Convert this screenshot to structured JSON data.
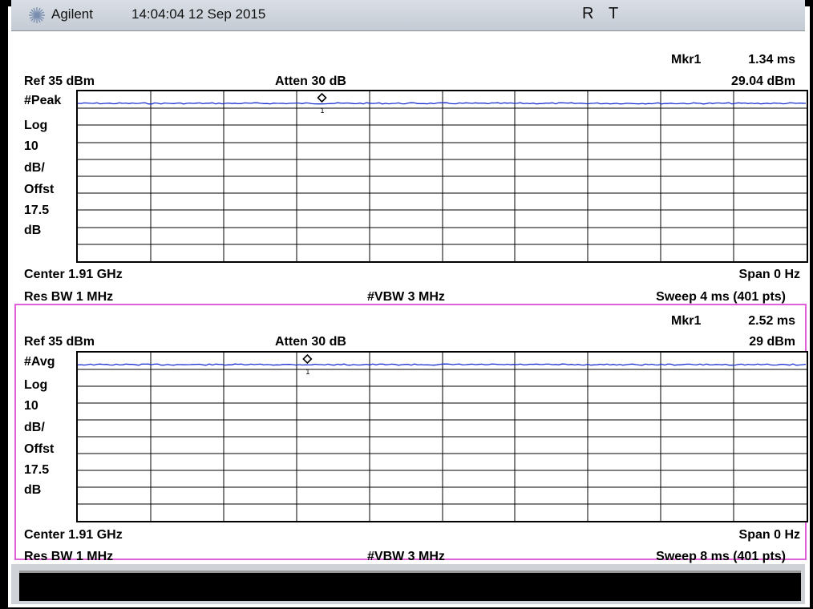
{
  "topbar": {
    "brand": "Agilent",
    "timestamp": "14:04:04  12 Sep 2015",
    "flag_r": "R",
    "flag_t": "T",
    "logo_icon": "agilent-spark-icon"
  },
  "panels": [
    {
      "marker_label": "Mkr1",
      "marker_time": "1.34 ms",
      "ref": "Ref 35 dBm",
      "atten": "Atten 30 dB",
      "marker_value": "29.04 dBm",
      "detector": "#Peak",
      "scale": [
        "Log",
        "10",
        "dB/",
        "Offst",
        "17.5",
        "dB"
      ],
      "center": "Center 1.91 GHz",
      "span": "Span 0 Hz",
      "rbw": "Res BW 1 MHz",
      "vbw": "#VBW 3 MHz",
      "sweep": "Sweep 4 ms (401 pts)",
      "marker_num": "1",
      "trace_color": "#1a2fd0",
      "marker_fraction_x": 0.335
    },
    {
      "marker_label": "Mkr1",
      "marker_time": "2.52 ms",
      "ref": "Ref 35 dBm",
      "atten": "Atten 30 dB",
      "marker_value": "29 dBm",
      "detector": "#Avg",
      "scale": [
        "Log",
        "10",
        "dB/",
        "Offst",
        "17.5",
        "dB"
      ],
      "center": "Center 1.91 GHz",
      "span": "Span 0 Hz",
      "rbw": "Res BW 1 MHz",
      "vbw": "#VBW 3 MHz",
      "sweep": "Sweep 8 ms (401 pts)",
      "marker_num": "1",
      "trace_color": "#1a2fd0",
      "marker_fraction_x": 0.315
    }
  ],
  "colors": {
    "active_pane_border": "#e060d8",
    "trace": "#1a2fd0"
  }
}
